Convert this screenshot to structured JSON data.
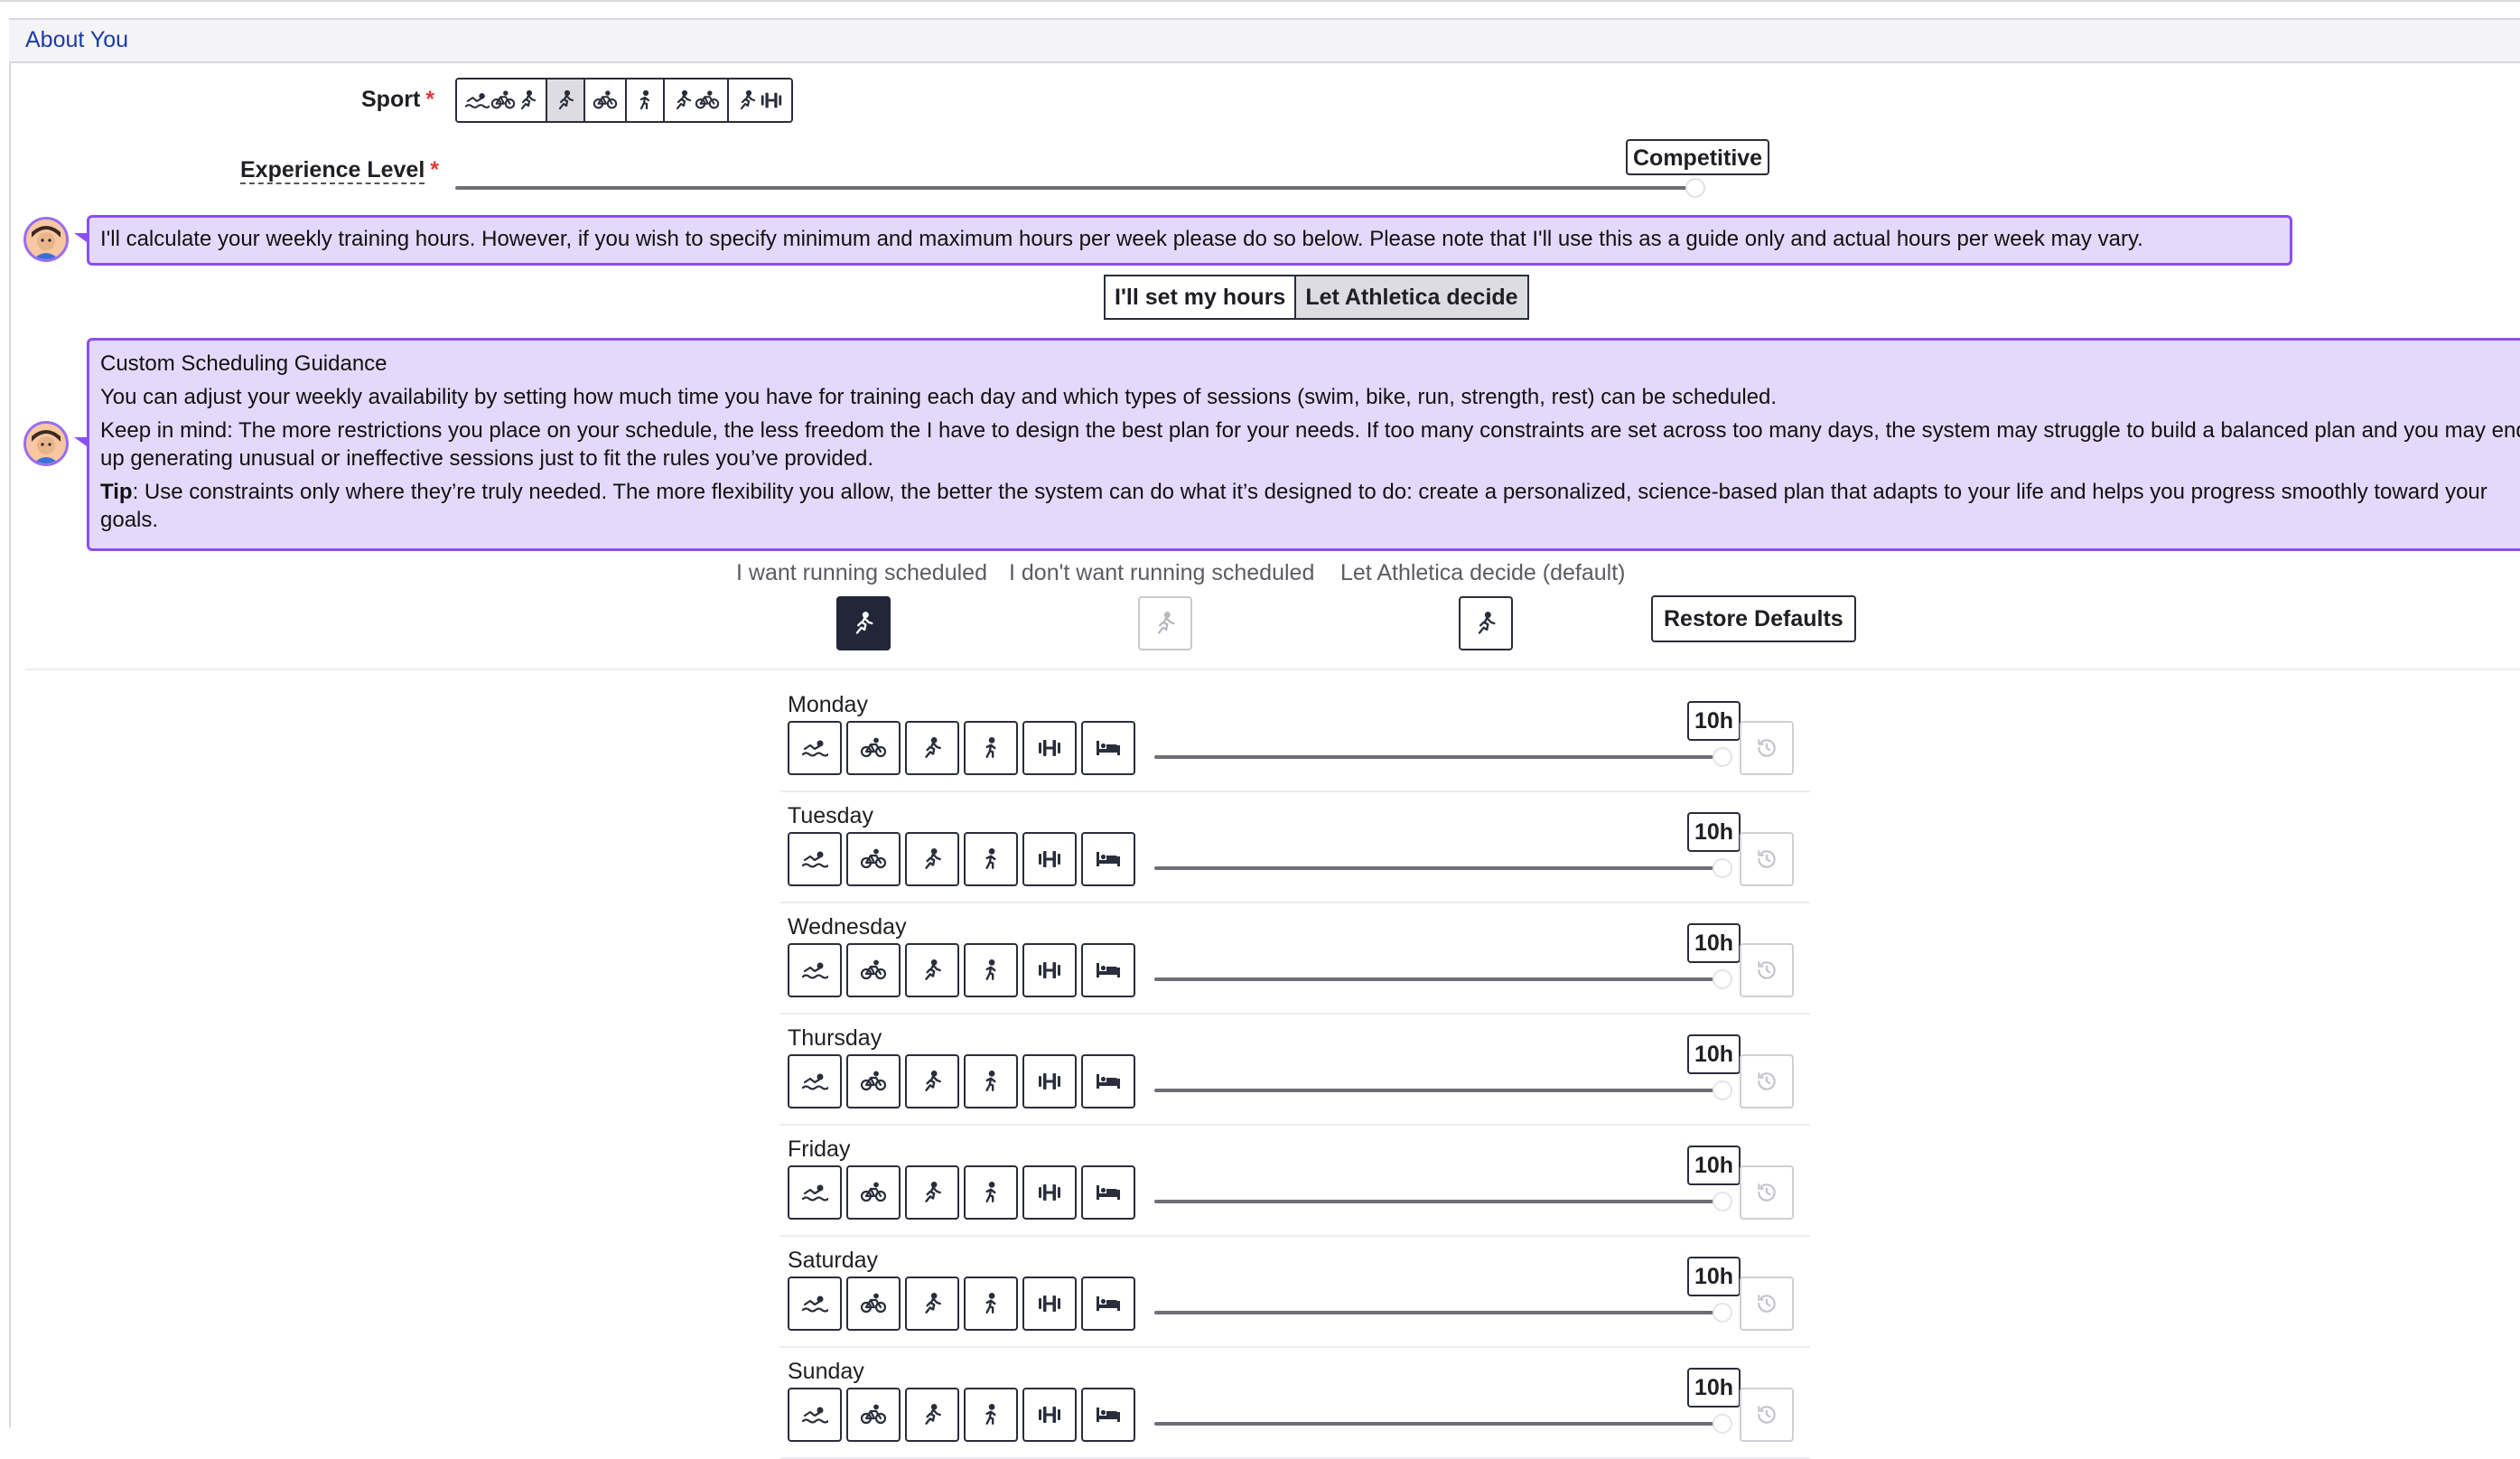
{
  "panel": {
    "title": "About You"
  },
  "sport": {
    "label": "Sport",
    "required_mark": "*",
    "options": [
      {
        "icons": [
          "swim-icon",
          "bike-icon",
          "run-icon"
        ],
        "selected": false
      },
      {
        "icons": [
          "run-icon"
        ],
        "selected": true
      },
      {
        "icons": [
          "bike-icon"
        ],
        "selected": false
      },
      {
        "icons": [
          "trail-run-icon"
        ],
        "selected": false
      },
      {
        "icons": [
          "run-icon",
          "bike-icon"
        ],
        "selected": false
      },
      {
        "icons": [
          "run-icon",
          "strength-icon"
        ],
        "selected": false
      }
    ]
  },
  "experience": {
    "label": "Experience Level",
    "required_mark": "*",
    "value": "Competitive",
    "level_fraction": 1.0
  },
  "hours_message": "I'll calculate your weekly training hours. However, if you wish to specify minimum and maximum hours per week please do so below. Please note that I'll use this as a guide only and actual hours per week may vary.",
  "hours_toggle": {
    "set_label": "I'll set my hours",
    "decide_label": "Let Athletica decide",
    "selected": "decide"
  },
  "guidance": {
    "title": "Custom Scheduling Guidance",
    "para1": "You can adjust your weekly availability by setting how much time you have for training each day and which types of sessions (swim, bike, run, strength, rest) can be scheduled.",
    "para2": "Keep in mind: The more restrictions you place on your schedule, the less freedom the I have to design the best plan for your needs. If too many constraints are set across too many days, the system may struggle to build a balanced plan and you may end up generating unusual or ineffective sessions just to fit the rules you’ve provided.",
    "tip_label": "Tip",
    "tip_text": ": Use constraints only where they’re truly needed. The more flexibility you allow, the better the system can do what it’s designed to do: create a personalized, science-based plan that adapts to your life and helps you progress smoothly toward your goals."
  },
  "running_pref": {
    "want": "I want running scheduled",
    "dont_want": "I don't want running scheduled",
    "decide": "Let Athletica decide (default)",
    "restore": "Restore Defaults"
  },
  "day_icons": [
    "swim-icon",
    "bike-icon",
    "run-icon",
    "trail-run-icon",
    "strength-icon",
    "rest-bed-icon"
  ],
  "days": [
    {
      "name": "Monday",
      "hours": "10h",
      "fraction": 1.0
    },
    {
      "name": "Tuesday",
      "hours": "10h",
      "fraction": 1.0
    },
    {
      "name": "Wednesday",
      "hours": "10h",
      "fraction": 1.0
    },
    {
      "name": "Thursday",
      "hours": "10h",
      "fraction": 1.0
    },
    {
      "name": "Friday",
      "hours": "10h",
      "fraction": 1.0
    },
    {
      "name": "Saturday",
      "hours": "10h",
      "fraction": 1.0
    },
    {
      "name": "Sunday",
      "hours": "10h",
      "fraction": 1.0
    }
  ],
  "colors": {
    "accent_purple": "#8c4ff0",
    "message_bg": "#e4d9fb",
    "title_blue": "#1c3aa8",
    "dark_button": "#222639",
    "required_red": "#e53935"
  }
}
